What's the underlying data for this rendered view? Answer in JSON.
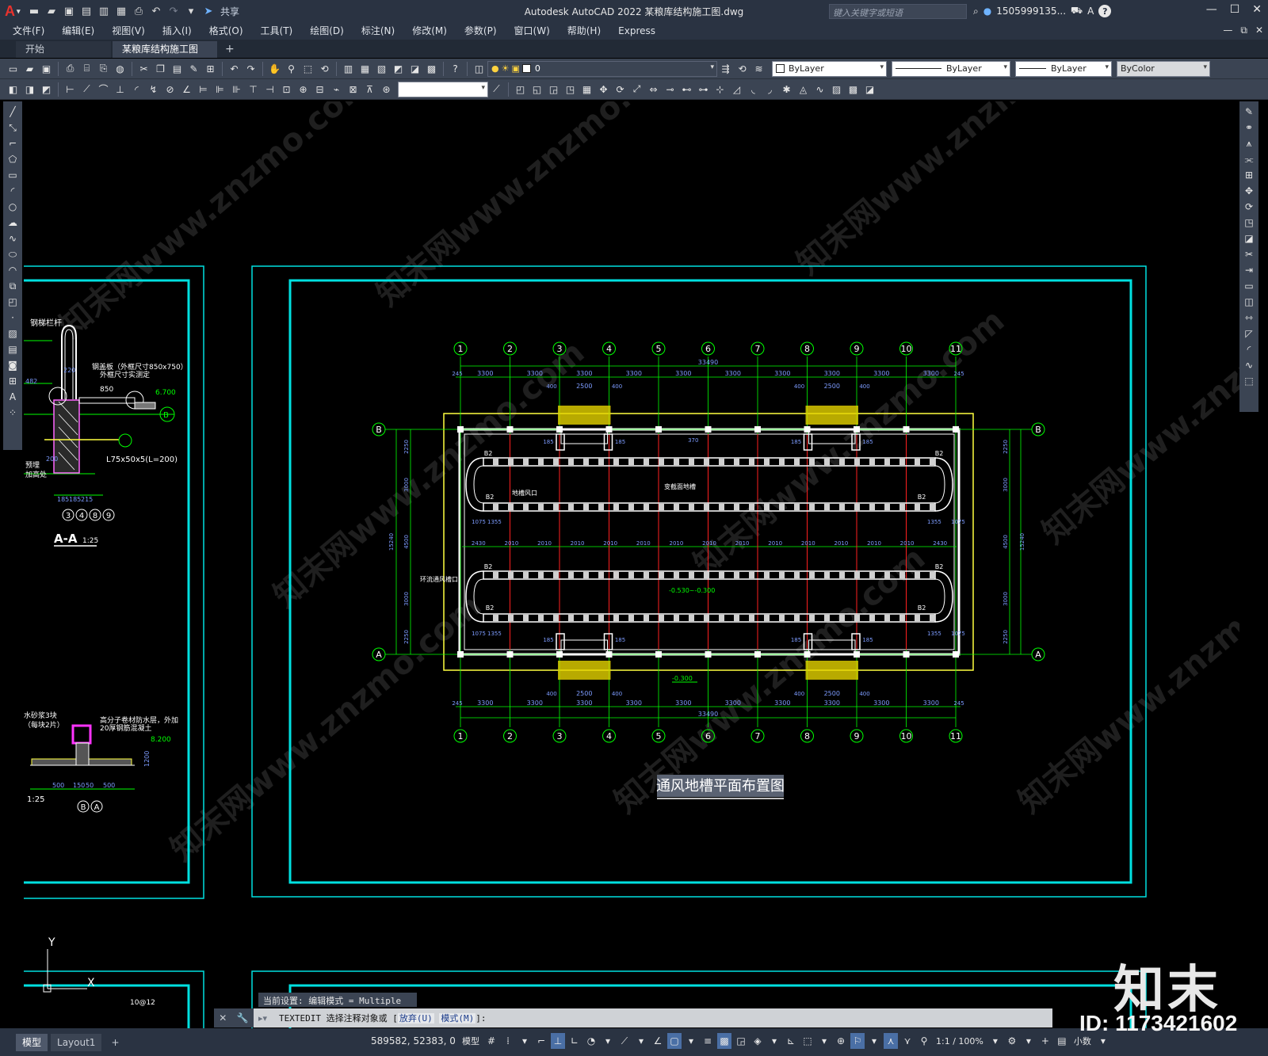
{
  "titlebar": {
    "app_letter": "A",
    "share": "共享",
    "title": "Autodesk AutoCAD 2022    某粮库结构施工图.dwg",
    "search_placeholder": "键入关键字或短语",
    "user": "1505999135...",
    "help": "?"
  },
  "menu": [
    "文件(F)",
    "编辑(E)",
    "视图(V)",
    "插入(I)",
    "格式(O)",
    "工具(T)",
    "绘图(D)",
    "标注(N)",
    "修改(M)",
    "参数(P)",
    "窗口(W)",
    "帮助(H)",
    "Express"
  ],
  "tabs": {
    "start": "开始",
    "drawing": "某粮库结构施工图*",
    "add": "+"
  },
  "toolbar": {
    "layer": "0",
    "color": "ByLayer",
    "linetype": "ByLayer",
    "lineweight": "ByLayer",
    "plotstyle": "ByColor"
  },
  "drawing": {
    "title": "通风地槽平面布置图",
    "axes_top": [
      "1",
      "2",
      "3",
      "4",
      "5",
      "6",
      "7",
      "8",
      "9",
      "10",
      "11"
    ],
    "axes_side": [
      "A",
      "B"
    ],
    "bay_dims": [
      "3300",
      "3300",
      "3300",
      "3300",
      "3300",
      "3300",
      "3300",
      "3300",
      "3300",
      "3300"
    ],
    "overall_dim": "33490",
    "edge_dim": "245",
    "door_dims": [
      "400",
      "2500",
      "400"
    ],
    "inner_dims": [
      "2430",
      "2010",
      "2010",
      "2010",
      "2010",
      "2010",
      "2010",
      "2010",
      "2010",
      "2010",
      "2010",
      "2010",
      "2010",
      "2010",
      "2430"
    ],
    "side_dims": [
      "2250",
      "3000",
      "4500",
      "3000",
      "2250"
    ],
    "side_total": "15240",
    "labels": {
      "b2": "B2",
      "air_inlet": "地槽风口",
      "section_trough": "变截面地槽",
      "ring_trough": "环流通风槽口",
      "elev1": "-0.530~-0.300",
      "elev2": "-0.300",
      "d1355": "1355",
      "d1075": "1075",
      "d185": "185",
      "d370": "370"
    },
    "left_detail": {
      "steel_rail": "钢梯栏杆",
      "cover_plate": "钢盖板（外框尺寸850x750）",
      "cover_note": "外框尺寸实测定",
      "angle": "L75x50x5(L=200)",
      "dim850": "850",
      "elev_6700": "6.700",
      "dim220": "220",
      "dim482": "482",
      "dim200": "200",
      "bottom_dims": [
        "185",
        "185",
        "215"
      ],
      "axis_refs": [
        "3",
        "4",
        "8",
        "9"
      ],
      "section_title": "A-A",
      "scale": "1:25",
      "wall_note1": "预埋",
      "wall_note2": "加高处",
      "lower_note1": "高分子卷材防水层，外加",
      "lower_note2": "20厚钢筋混凝土",
      "lower_left1": "水砂浆3块",
      "lower_left2": "（每块2片）",
      "elev_8200": "8.200",
      "lower_dims": [
        "500",
        "150",
        "50",
        "500"
      ],
      "lower_axes": [
        "B",
        "A"
      ],
      "lower_scale": "1:25",
      "dim_1200": "1200",
      "rebar": "10@12"
    },
    "ucs": {
      "x": "X",
      "y": "Y"
    }
  },
  "command": {
    "history": "当前设置: 编辑模式 = Multiple",
    "prefix": "TEXTEDIT",
    "prompt": "选择注释对象或 [",
    "opt1": "放弃(U)",
    "opt2": "模式(M)",
    "end": "]:"
  },
  "status": {
    "model_tab": "模型",
    "layout_tab": "Layout1",
    "coords": "589582, 52383, 0",
    "model_label": "模型",
    "scale": "1:1 / 100%",
    "units": "小数"
  },
  "watermark": {
    "brand": "知末",
    "id": "ID: 1173421602",
    "repeat": "知末网www.znzmo.com"
  },
  "colors": {
    "chrome": "#2a3342",
    "toolbar": "#3b4453",
    "frame": "#00ffff",
    "axis": "#00ff00",
    "dims": "#7d9cff",
    "red": "#ff2020",
    "yellow": "#ffff40"
  }
}
